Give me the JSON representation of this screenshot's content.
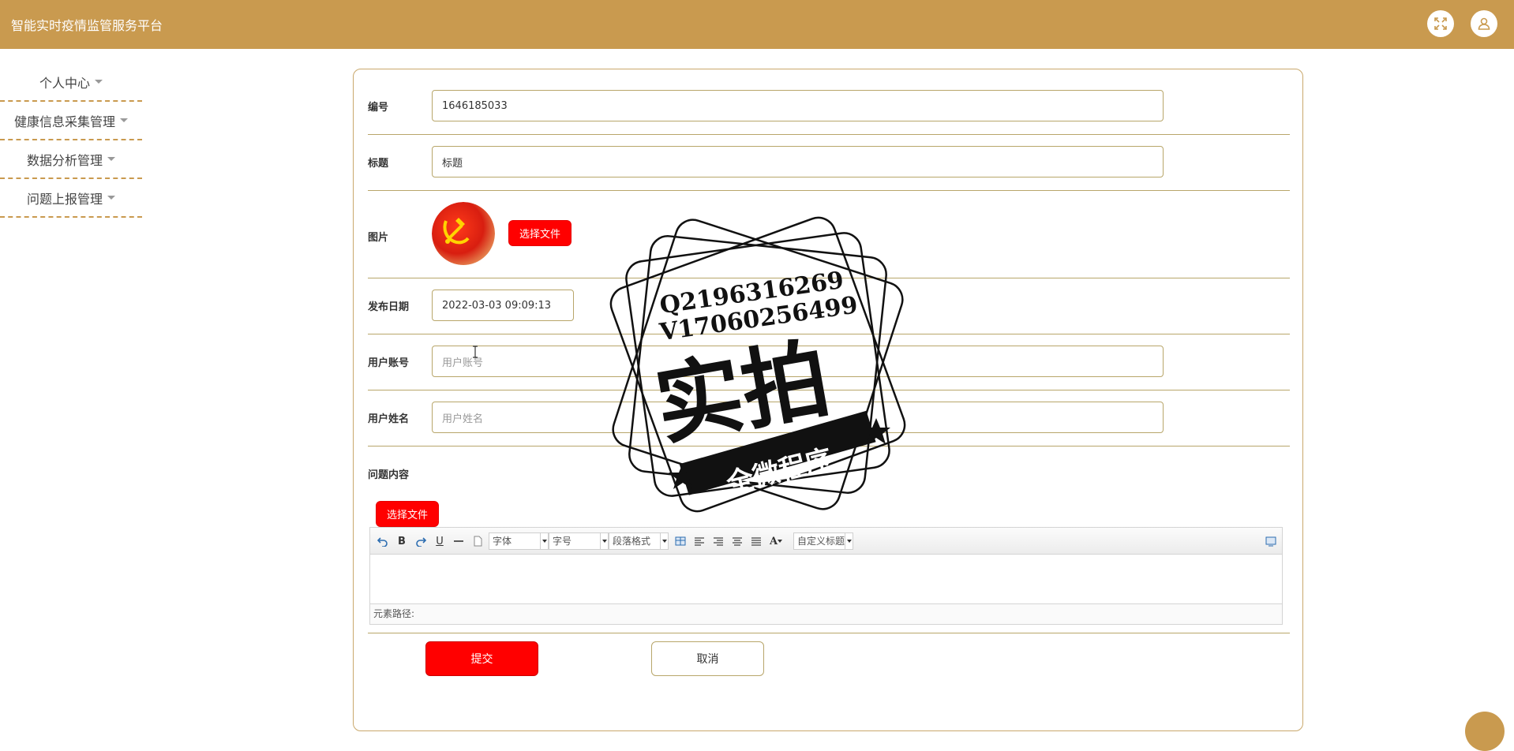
{
  "app": {
    "title": "智能实时疫情监管服务平台"
  },
  "sidebar": {
    "items": [
      {
        "label": "个人中心"
      },
      {
        "label": "健康信息采集管理"
      },
      {
        "label": "数据分析管理"
      },
      {
        "label": "问题上报管理"
      }
    ]
  },
  "form": {
    "fields": {
      "number": {
        "label": "编号",
        "value": "1646185033"
      },
      "title": {
        "label": "标题",
        "value": "标题"
      },
      "image": {
        "label": "图片",
        "button": "选择文件"
      },
      "publish_date": {
        "label": "发布日期",
        "value": "2022-03-03 09:09:13"
      },
      "user_account": {
        "label": "用户账号",
        "placeholder": "用户账号"
      },
      "user_name": {
        "label": "用户姓名",
        "placeholder": "用户姓名"
      },
      "problem_content": {
        "label": "问题内容",
        "button": "选择文件"
      }
    },
    "editor": {
      "font_select": "字体",
      "size_select": "字号",
      "paragraph_select": "段落格式",
      "custom_title_select": "自定义标题",
      "bold": "B",
      "underline": "U",
      "font_color": "A",
      "status_path": "元素路径:"
    },
    "actions": {
      "submit": "提交",
      "cancel": "取消"
    }
  },
  "watermark": {
    "line1": "Q2196316269",
    "line2": "V17060256499",
    "main": "实拍",
    "banner": "全微程序"
  },
  "colors": {
    "primary": "#c99a4f",
    "danger": "#ff0000",
    "border": "#b8a66a"
  }
}
